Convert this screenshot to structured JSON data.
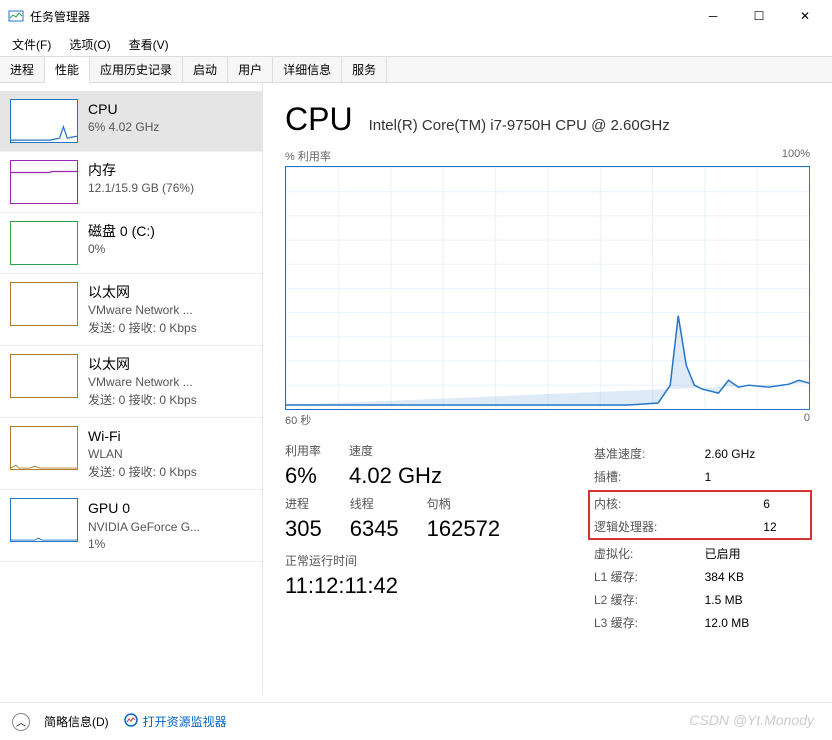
{
  "window": {
    "title": "任务管理器"
  },
  "menu": {
    "file": "文件(F)",
    "options": "选项(O)",
    "view": "查看(V)"
  },
  "tabs": [
    "进程",
    "性能",
    "应用历史记录",
    "启动",
    "用户",
    "详细信息",
    "服务"
  ],
  "sidebar": {
    "items": [
      {
        "name": "CPU",
        "line1": "6% 4.02 GHz",
        "line2": "",
        "color": "#2575c7"
      },
      {
        "name": "内存",
        "line1": "12.1/15.9 GB (76%)",
        "line2": "",
        "color": "#9b27b0"
      },
      {
        "name": "磁盘 0 (C:)",
        "line1": "0%",
        "line2": "",
        "color": "#2e9e4d"
      },
      {
        "name": "以太网",
        "line1": "VMware Network ...",
        "line2": "发送: 0 接收: 0 Kbps",
        "color": "#b07b2e"
      },
      {
        "name": "以太网",
        "line1": "VMware Network ...",
        "line2": "发送: 0 接收: 0 Kbps",
        "color": "#b07b2e"
      },
      {
        "name": "Wi-Fi",
        "line1": "WLAN",
        "line2": "发送: 0 接收: 0 Kbps",
        "color": "#b07b2e"
      },
      {
        "name": "GPU 0",
        "line1": "NVIDIA GeForce G...",
        "line2": "1%",
        "color": "#2575c7"
      }
    ]
  },
  "main": {
    "title": "CPU",
    "subtitle": "Intel(R) Core(TM) i7-9750H CPU @ 2.60GHz",
    "chartTop": {
      "left": "% 利用率",
      "right": "100%"
    },
    "chartBottom": {
      "left": "60 秒",
      "right": "0"
    },
    "stats": {
      "util": {
        "label": "利用率",
        "value": "6%"
      },
      "speed": {
        "label": "速度",
        "value": "4.02 GHz"
      },
      "processes": {
        "label": "进程",
        "value": "305"
      },
      "threads": {
        "label": "线程",
        "value": "6345"
      },
      "handles": {
        "label": "句柄",
        "value": "162572"
      },
      "uptime": {
        "label": "正常运行时间",
        "value": "11:12:11:42"
      }
    },
    "details": {
      "baseSpeed": {
        "label": "基准速度:",
        "value": "2.60 GHz"
      },
      "sockets": {
        "label": "插槽:",
        "value": "1"
      },
      "cores": {
        "label": "内核:",
        "value": "6"
      },
      "logical": {
        "label": "逻辑处理器:",
        "value": "12"
      },
      "virt": {
        "label": "虚拟化:",
        "value": "已启用"
      },
      "l1": {
        "label": "L1 缓存:",
        "value": "384 KB"
      },
      "l2": {
        "label": "L2 缓存:",
        "value": "1.5 MB"
      },
      "l3": {
        "label": "L3 缓存:",
        "value": "12.0 MB"
      }
    }
  },
  "footer": {
    "simple": "简略信息(D)",
    "monitor": "打开资源监视器"
  },
  "watermark": "CSDN @Yt.Monody",
  "chart_data": {
    "type": "line",
    "title": "% 利用率",
    "xlabel": "60 秒",
    "ylabel": "% 利用率",
    "ylim": [
      0,
      100
    ],
    "xlim": [
      60,
      0
    ],
    "x": [
      60,
      56,
      52,
      48,
      44,
      40,
      36,
      32,
      28,
      24,
      20,
      16,
      12,
      10,
      8,
      7,
      6,
      5,
      4,
      3,
      2,
      1,
      0
    ],
    "values": [
      2,
      2,
      2,
      2,
      2,
      2,
      2,
      2,
      2,
      2,
      2,
      2,
      3,
      10,
      38,
      18,
      10,
      8,
      7,
      6,
      10,
      8,
      9
    ]
  }
}
